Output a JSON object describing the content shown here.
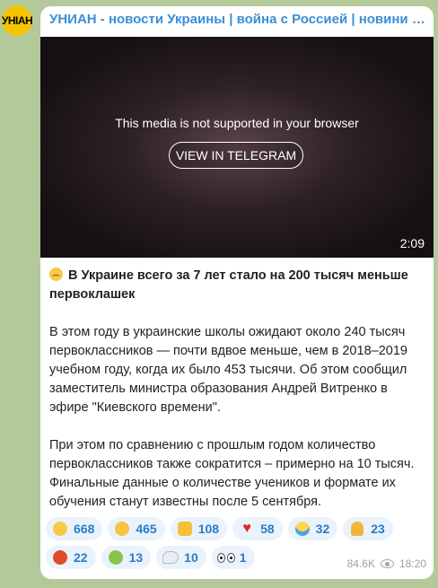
{
  "channel": {
    "title": "УНИАН - новости Украины | война с Россией | новини України | війна з Росією",
    "avatar_text": "УНІАН"
  },
  "media": {
    "unsupported_text": "This media is not supported in your browser",
    "view_button": "VIEW IN TELEGRAM",
    "duration": "2:09"
  },
  "post": {
    "headline": "В Украине всего за 7 лет стало на 200 тысяч меньше первоклашек",
    "paragraphs": [
      "В этом году в украинские школы ожидают около 240 тысяч первоклассников — почти вдвое меньше, чем в 2018–2019 учебном году, когда их было 453 тысячи. Об этом сообщил заместитель министра образования Андрей Витренко в эфире \"Киевского времени\".",
      "При этом по сравнению с прошлым годом количество первоклассников также сократится – примерно на 10 тысяч. Финальные данные о количестве учеников и формате их обучения станут известны после 5 сентября."
    ]
  },
  "reactions": [
    {
      "emoji": "sad-face",
      "count": "668"
    },
    {
      "emoji": "grinning-face",
      "count": "465"
    },
    {
      "emoji": "thumbs-up",
      "count": "108"
    },
    {
      "emoji": "red-heart",
      "count": "58"
    },
    {
      "emoji": "screaming-face",
      "count": "32"
    },
    {
      "emoji": "folded-hands",
      "count": "23"
    },
    {
      "emoji": "angry-face",
      "count": "22"
    },
    {
      "emoji": "nauseated-face",
      "count": "13"
    },
    {
      "emoji": "dove",
      "count": "10"
    },
    {
      "emoji": "eyes",
      "count": "1"
    }
  ],
  "meta": {
    "views": "84.6K",
    "time": "18:20"
  },
  "colors": {
    "accent": "#3a8fd6",
    "background": "#b3c99a",
    "reaction_bg": "#eaf3fc"
  }
}
